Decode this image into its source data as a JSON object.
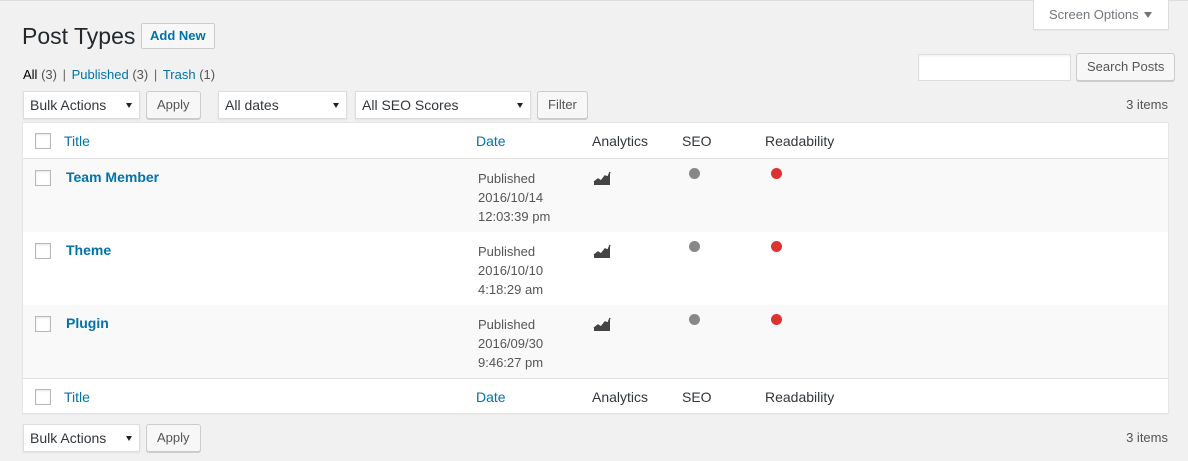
{
  "screen_options": {
    "label": "Screen Options"
  },
  "page": {
    "title": "Post Types",
    "add_new_label": "Add New"
  },
  "views": [
    {
      "label": "All",
      "count": "(3)"
    },
    {
      "label": "Published",
      "count": "(3)"
    },
    {
      "label": "Trash",
      "count": "(1)"
    }
  ],
  "search": {
    "placeholder": "",
    "button_label": "Search Posts"
  },
  "filters": {
    "bulk_actions": "Bulk Actions",
    "apply_label": "Apply",
    "dates": "All dates",
    "seo_scores": "All SEO Scores",
    "filter_label": "Filter",
    "items_count": "3 items"
  },
  "table": {
    "columns": {
      "title": "Title",
      "date": "Date",
      "analytics": "Analytics",
      "seo": "SEO",
      "readability": "Readability"
    },
    "rows": [
      {
        "title": "Team Member",
        "status": "Published",
        "date": "2016/10/14",
        "time": "12:03:39 pm"
      },
      {
        "title": "Theme",
        "status": "Published",
        "date": "2016/10/10",
        "time": "4:18:29 am"
      },
      {
        "title": "Plugin",
        "status": "Published",
        "date": "2016/09/30",
        "time": "9:46:27 pm"
      }
    ]
  },
  "bottom": {
    "bulk_actions": "Bulk Actions",
    "apply_label": "Apply",
    "items_count": "3 items"
  },
  "colors": {
    "link": "#0073aa",
    "seo_dot": "#888888",
    "readability_dot": "#dc3232"
  },
  "icons": {
    "analytics": "analytics-chart-icon"
  }
}
